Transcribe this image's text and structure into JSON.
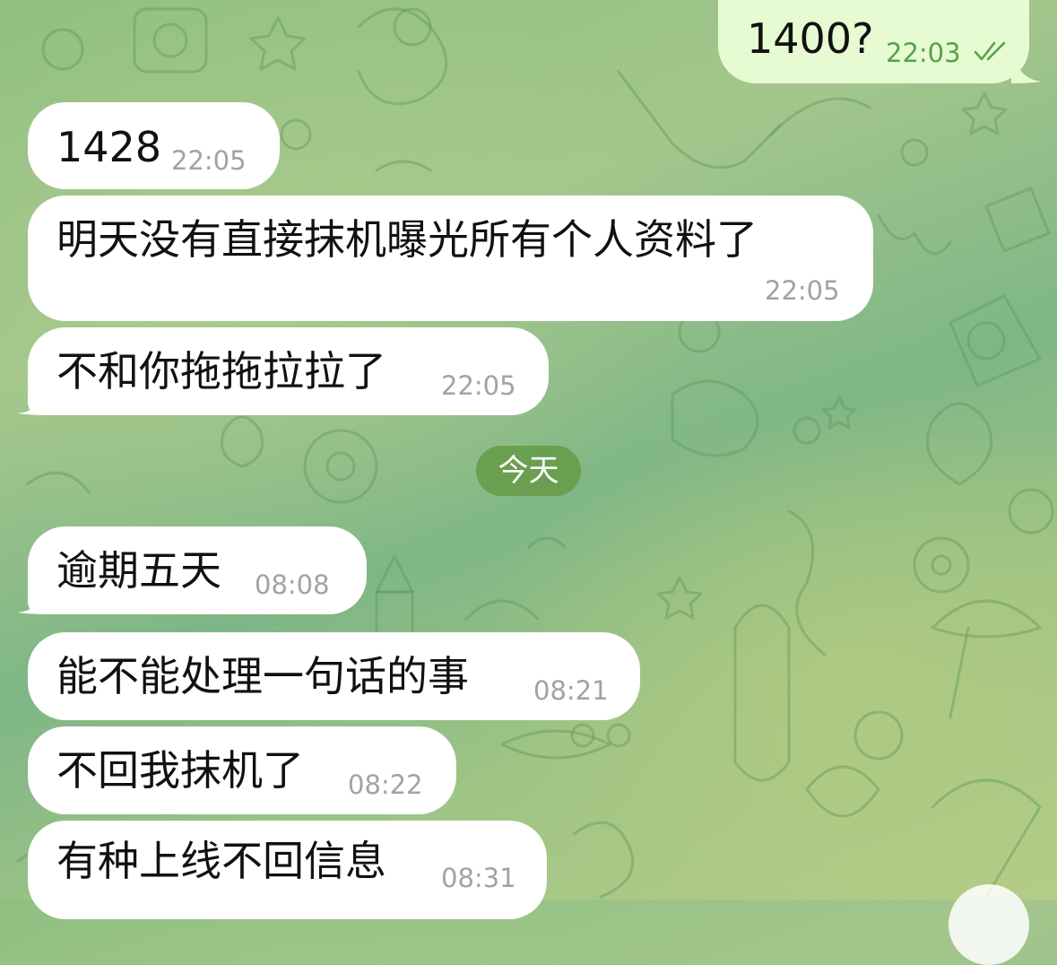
{
  "messages": [
    {
      "text": "1400?",
      "time": "22:03",
      "direction": "outgoing",
      "status": "read"
    },
    {
      "text": "1428",
      "time": "22:05",
      "direction": "incoming"
    },
    {
      "text": "明天没有直接抹机曝光所有个人资料了",
      "time": "22:05",
      "direction": "incoming"
    },
    {
      "text": "不和你拖拖拉拉了",
      "time": "22:05",
      "direction": "incoming"
    },
    {
      "text": "逾期五天",
      "time": "08:08",
      "direction": "incoming"
    },
    {
      "text": "能不能处理一句话的事",
      "time": "08:21",
      "direction": "incoming"
    },
    {
      "text": "不回我抹机了",
      "time": "08:22",
      "direction": "incoming"
    },
    {
      "text": "有种上线不回信息",
      "time": "08:31",
      "direction": "incoming"
    }
  ],
  "date_separator": "今天",
  "colors": {
    "incoming_bubble": "#ffffff",
    "outgoing_bubble": "#e7fbd2",
    "outgoing_meta": "#55a24a",
    "date_pill": "#6a9f4f"
  }
}
